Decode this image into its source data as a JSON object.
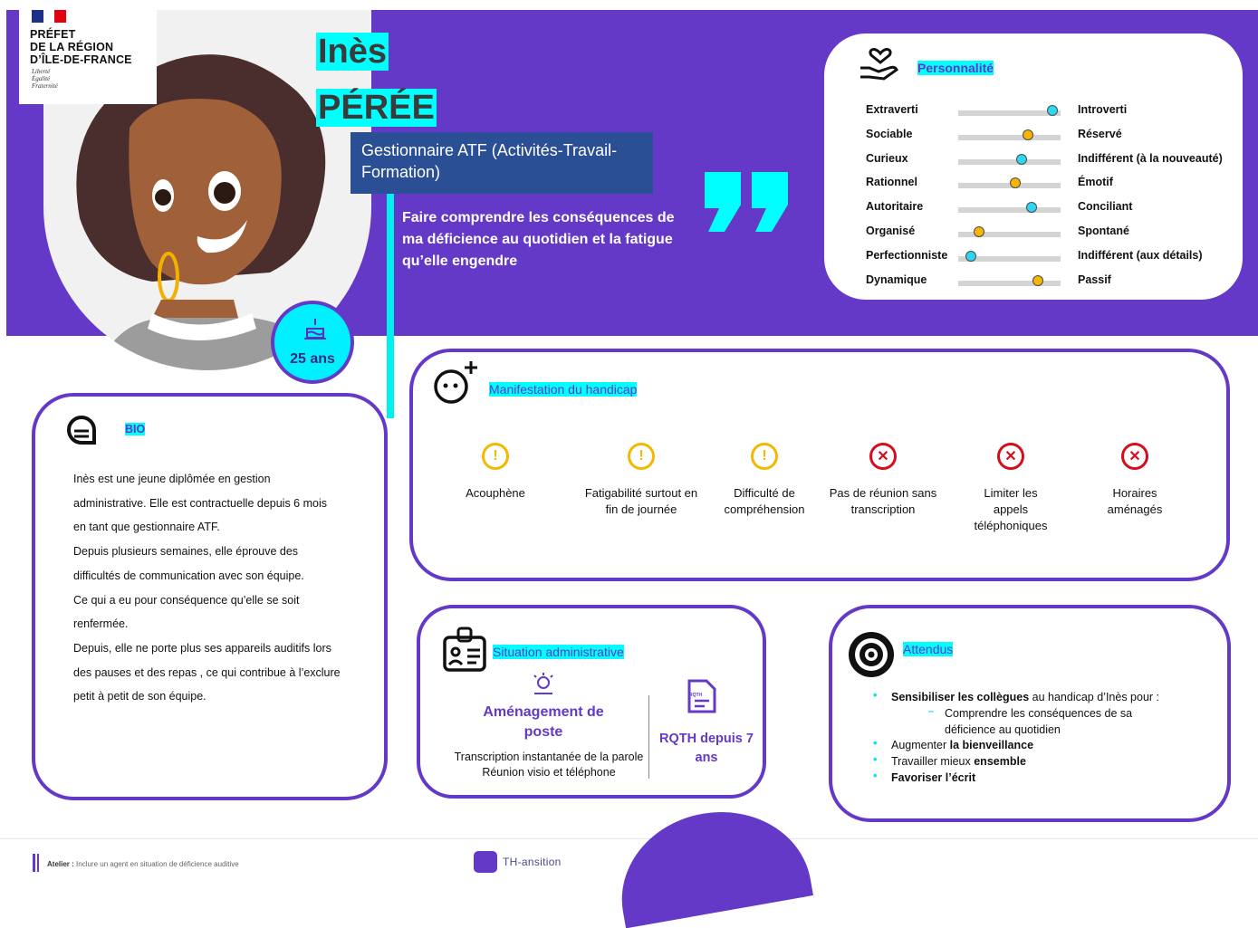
{
  "header": {
    "prefecture": [
      "PRÉFET",
      "DE LA RÉGION",
      "D’ÎLE-DE-FRANCE"
    ],
    "motto": [
      "Liberté",
      "Égalité",
      "Fraternité"
    ],
    "first_name": "Inès",
    "last_name": "PÉRÉE",
    "job_title": "Gestionnaire ATF (Activités-Travail-Formation)",
    "quote": "Faire comprendre  les conséquences de ma déficience au quotidien et la fatigue qu’elle engendre",
    "age": "25 ans"
  },
  "personality": {
    "title": "Personnalité",
    "rows": [
      {
        "left": "Extraverti",
        "right": "Introverti",
        "value": 0.92,
        "color": "#2fd6f2"
      },
      {
        "left": "Sociable",
        "right": "Réservé",
        "value": 0.68,
        "color": "#f7b500"
      },
      {
        "left": "Curieux",
        "right": "Indifférent (à la nouveauté)",
        "value": 0.62,
        "color": "#2fd6f2"
      },
      {
        "left": "Rationnel",
        "right": "Émotif",
        "value": 0.56,
        "color": "#f7b500"
      },
      {
        "left": "Autoritaire",
        "right": "Conciliant",
        "value": 0.72,
        "color": "#2fd6f2"
      },
      {
        "left": "Organisé",
        "right": "Spontané",
        "value": 0.2,
        "color": "#f7b500"
      },
      {
        "left": "Perfectionniste",
        "right": "Indifférent (aux détails)",
        "value": 0.12,
        "color": "#2fd6f2"
      },
      {
        "left": "Dynamique",
        "right": "Passif",
        "value": 0.78,
        "color": "#f7b500"
      }
    ]
  },
  "bio": {
    "title": "BIO",
    "lines": [
      "Inès est une jeune diplômée en gestion",
      "administrative. Elle est contractuelle depuis 6 mois",
      "en tant que gestionnaire ATF.",
      "Depuis plusieurs semaines, elle éprouve des",
      "difficultés de communication avec son équipe.",
      "Ce qui a eu pour conséquence qu’elle se soit",
      "renfermée.",
      "Depuis, elle ne porte plus ses appareils auditifs lors",
      "des pauses et des repas , ce qui contribue à l’exclure",
      "petit à petit de son équipe."
    ]
  },
  "manifestation": {
    "title": "Manifestation du handicap",
    "items": [
      {
        "label": "Acouphène",
        "type": "warn"
      },
      {
        "label": "Fatigabilité surtout en fin de journée",
        "type": "warn"
      },
      {
        "label": "Difficulté de compréhension",
        "type": "warn"
      },
      {
        "label": "Pas de réunion sans transcription",
        "type": "err"
      },
      {
        "label": "Limiter les appels téléphoniques",
        "type": "err"
      },
      {
        "label": "Horaires aménagés",
        "type": "err"
      }
    ]
  },
  "admin": {
    "title": "Situation administrative",
    "amenagement_title": "Aménagement de poste",
    "amenagement_lines": [
      "Transcription instantanée de la parole",
      "Réunion visio et téléphone"
    ],
    "rqth_icon_text": "RQTH",
    "rqth_title": "RQTH depuis 7 ans"
  },
  "attendus": {
    "title": "Attendus",
    "b1_bold": "Sensibiliser les collègues",
    "b1_rest": " au handicap d’Inès pour :",
    "sub": "Comprendre les conséquences de sa déficience au quotidien",
    "b2_pre": "Augmenter ",
    "b2_bold": "la bienveillance",
    "b3_pre": "Travailler mieux ",
    "b3_bold": "ensemble",
    "b4_bold": "Favoriser l’écrit"
  },
  "footer": {
    "atelier_label": "Atelier :",
    "atelier_text": " Inclure un agent en situation de déficience auditive",
    "brand": "TH-ansition"
  },
  "colors": {
    "purple": "#6439c8",
    "cyan": "#00ffff",
    "navy": "#2b4f94",
    "warn": "#f3b800",
    "err": "#d40e1e"
  }
}
